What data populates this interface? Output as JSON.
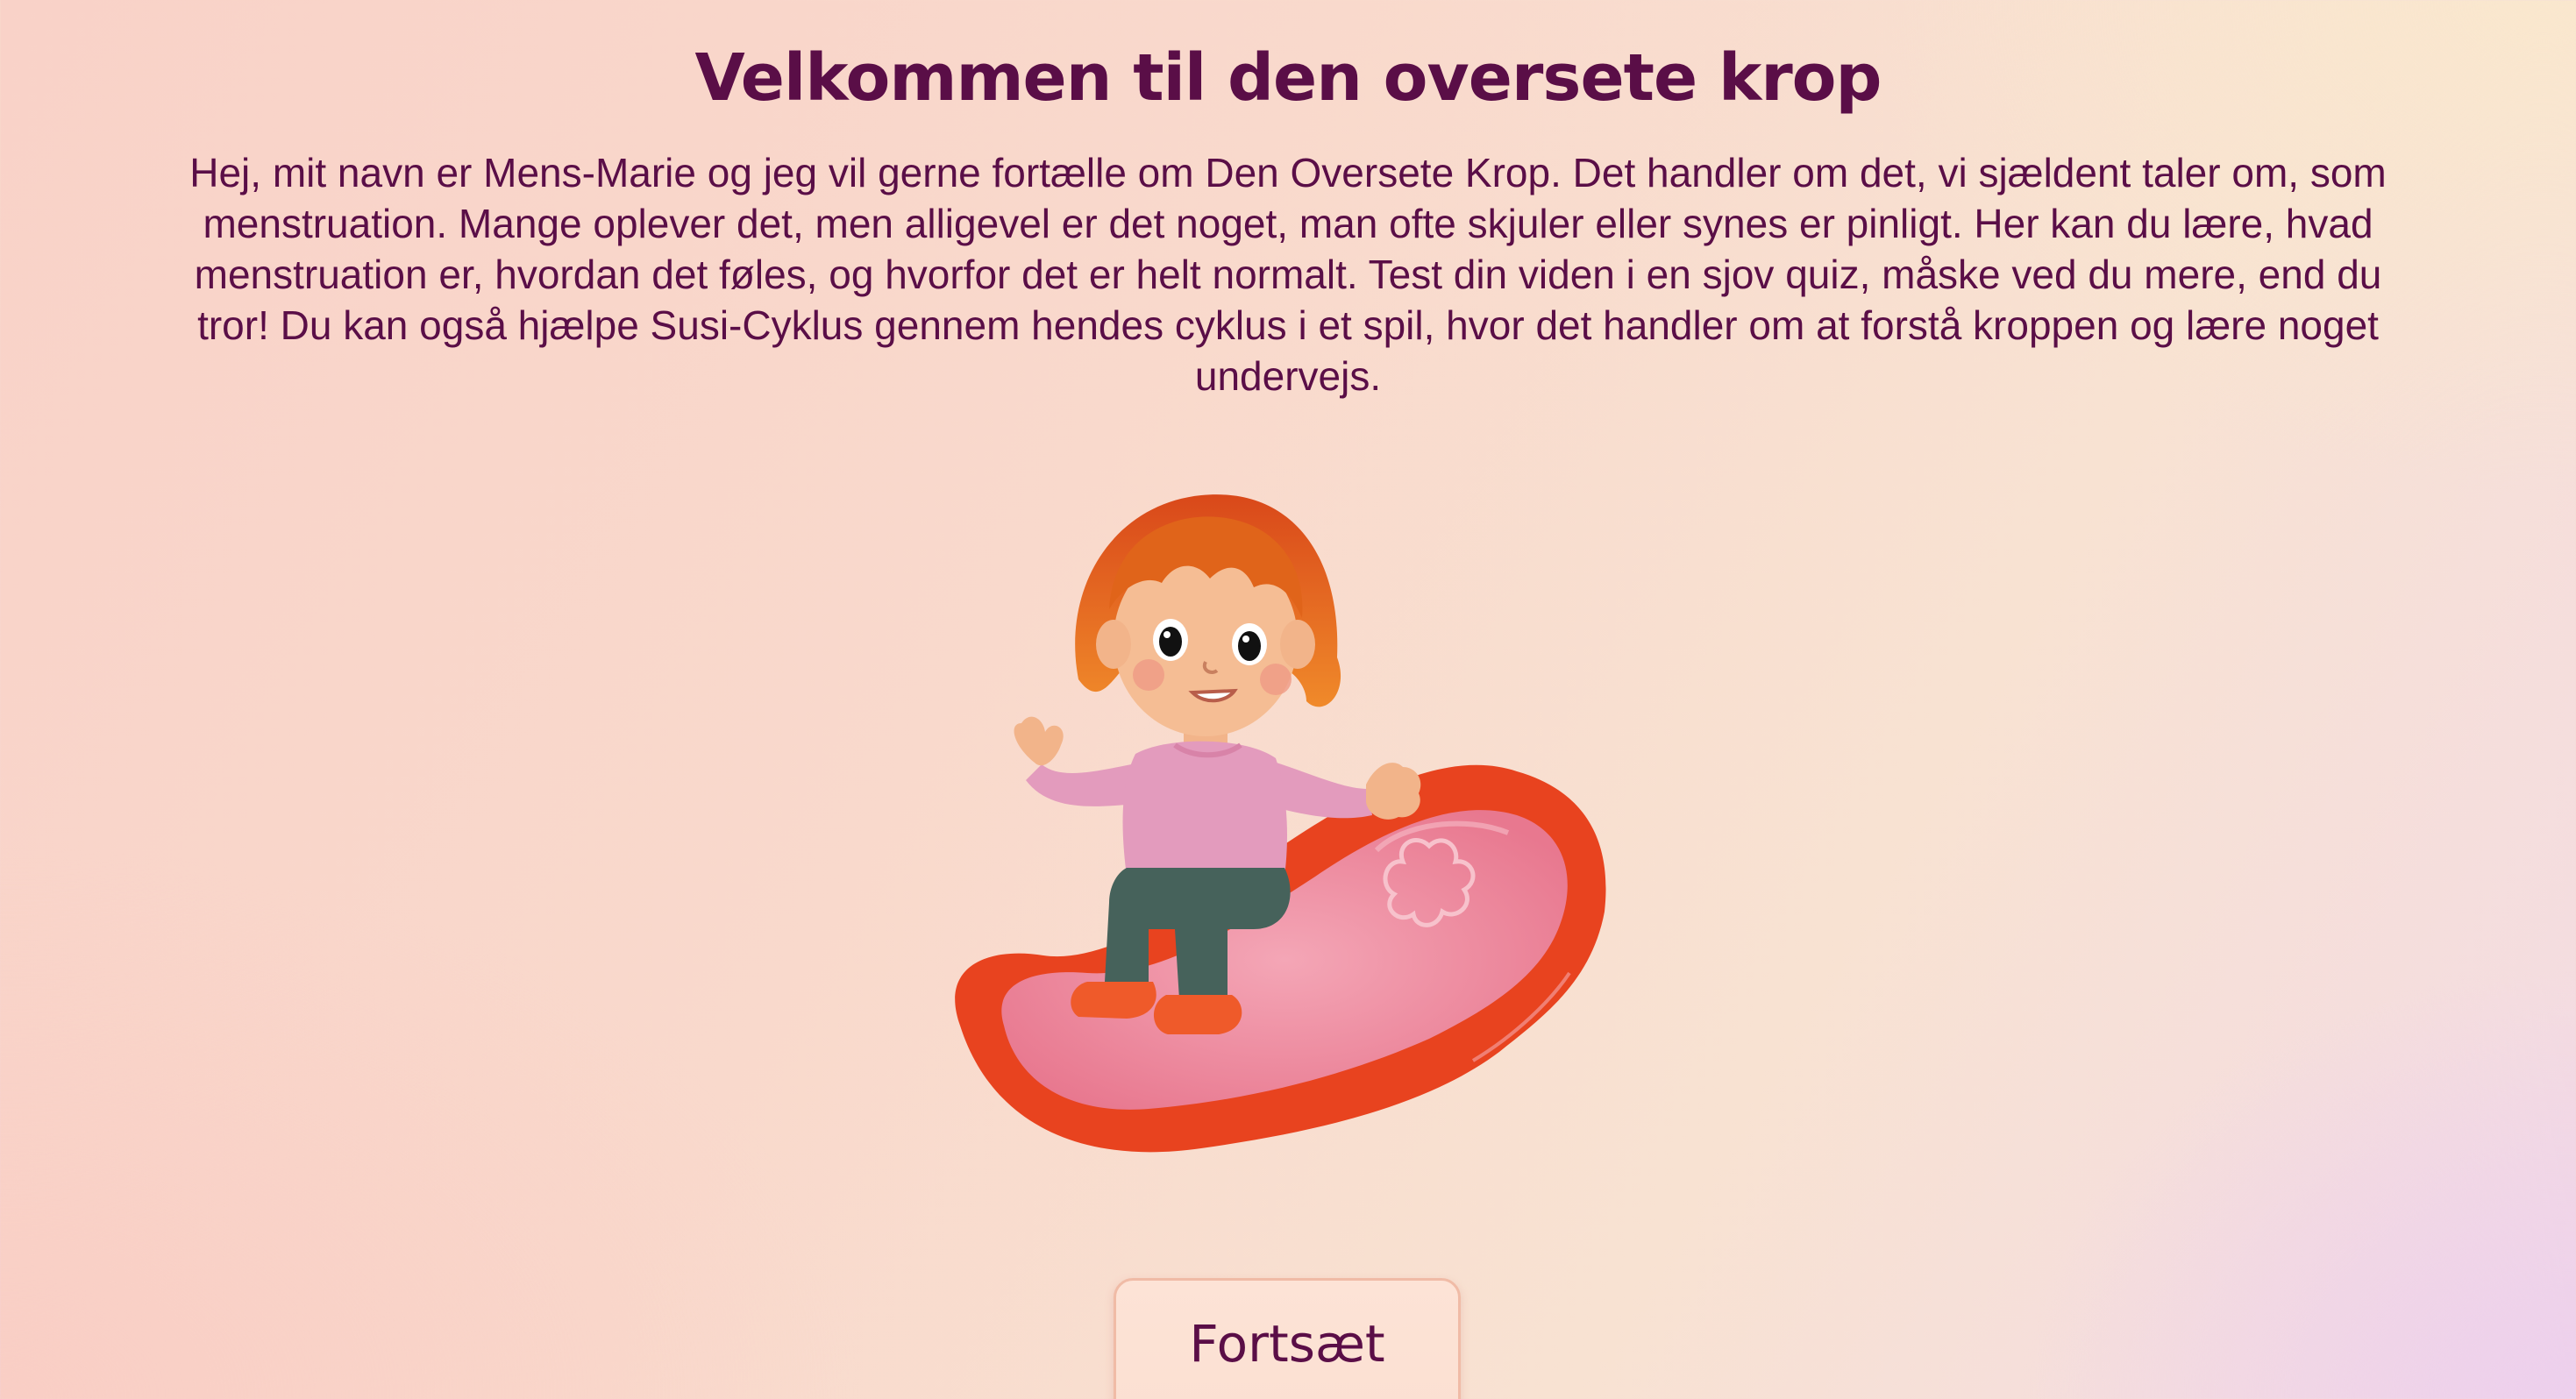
{
  "page": {
    "title": "Velkommen til den oversete krop",
    "intro": "Hej, mit navn er Mens-Marie og jeg vil gerne fortælle om Den Oversete Krop. Det handler om det, vi sjældent taler om, som menstruation. Mange oplever det, men alligevel er det noget, man ofte skjuler eller synes er pinligt. Her kan du lære, hvad menstruation er, hvordan det føles, og hvorfor det er helt normalt. Test din viden i en sjov quiz, måske ved du mere, end du tror! Du kan også hjælpe Susi-Cyklus gennem hendes cyklus i et spil, hvor det handler om at forstå kroppen og lære noget undervejs.",
    "continue_label": "Fortsæt"
  },
  "illustration": {
    "icon": "mens-marie-on-pad-illustration"
  },
  "colors": {
    "text": "#5a0e47",
    "pad_outer": "#e8431f",
    "pad_inner": "#ec8aa0",
    "hair": "#e0641a",
    "sweater": "#e39bbd",
    "pants": "#46625b",
    "shoes": "#ef5a2a"
  }
}
